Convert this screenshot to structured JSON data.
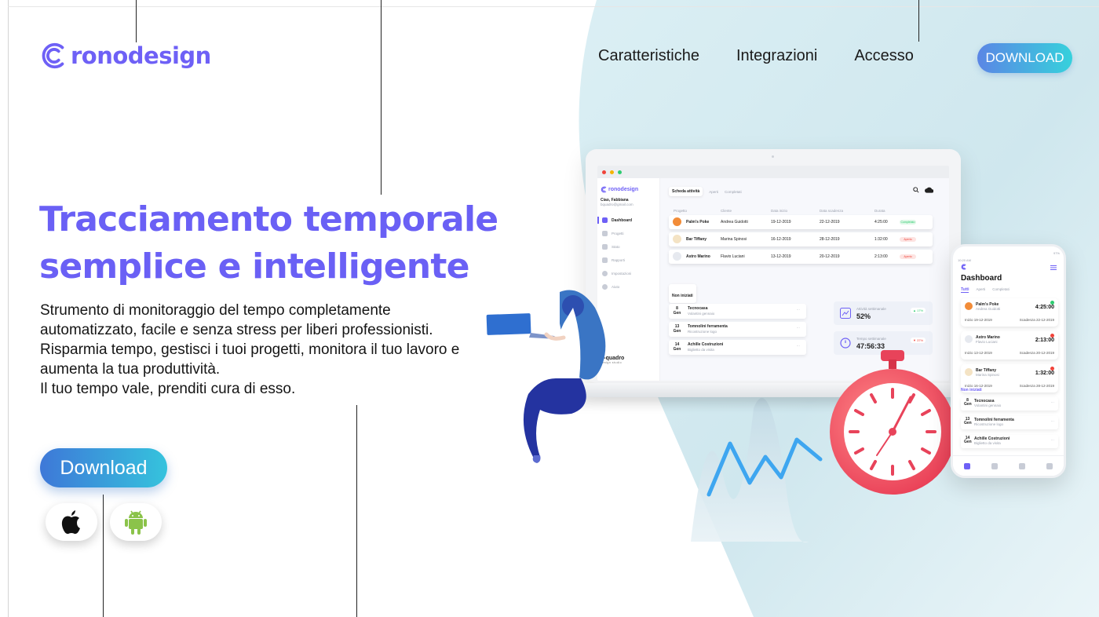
{
  "brand": {
    "logo_text": "ronodesign",
    "logo_letter": "C",
    "colors": {
      "primary": "#6a60f5",
      "cta_start": "#5b86e5",
      "cta_end": "#36d1dc"
    }
  },
  "nav": {
    "items": [
      "Caratteristiche",
      "Integrazioni",
      "Accesso"
    ],
    "cta_label": "DOWNLOAD"
  },
  "hero": {
    "title_line1": "Tracciamento temporale",
    "title_line2": "semplice e intelligente",
    "description": [
      "Strumento di monitoraggio del tempo completamente automatizzato, facile e senza stress per liberi professionisti.",
      "Risparmia tempo, gestisci i tuoi progetti, monitora il tuo lavoro e aumenta la tua produttività.",
      "Il tuo tempo vale, prenditi cura di esso."
    ],
    "download_label": "Download",
    "stores": [
      {
        "name": "apple",
        "icon": "apple-icon"
      },
      {
        "name": "android",
        "icon": "android-icon"
      }
    ]
  },
  "laptop_app": {
    "logo_text": "ronodesign",
    "user_name": "Ciao, Fabbiana",
    "user_email": "bquadro@gmail.com",
    "sidebar": [
      "Dashboard",
      "Progetti",
      "Stato",
      "Rapporti",
      "Impostazioni",
      "Aiuto"
    ],
    "sidebar_footer": "b-quadro",
    "sidebar_footer_sub": "design studio",
    "tabs": [
      "Scheda attività",
      "Aperti",
      "Completati"
    ],
    "table_headers": [
      "Progetto",
      "Cliente",
      "Data inizio",
      "Data scadenza",
      "Durata"
    ],
    "rows": [
      {
        "project": "Palm's Poke",
        "client": "Andrea Guidotti",
        "start": "19-12-2019",
        "end": "22-12-2019",
        "duration": "4:25:00",
        "status": "Completato",
        "status_color": "#2ecc71"
      },
      {
        "project": "Bar Tiffany",
        "client": "Marina Spinosi",
        "start": "16-12-2019",
        "end": "28-12-2019",
        "duration": "1:32:00",
        "status": "Aperto",
        "status_color": "#f0433a"
      },
      {
        "project": "Astro Marino",
        "client": "Flavio Luciani",
        "start": "13-12-2019",
        "end": "20-12-2019",
        "duration": "2:13:00",
        "status": "Aperto",
        "status_color": "#f0433a"
      }
    ],
    "not_started_label": "Non iniziati",
    "tasks": [
      {
        "day": "8",
        "month": "Gen",
        "title": "Tecnocasa",
        "sub": "Volantini gennaio"
      },
      {
        "day": "13",
        "month": "Gen",
        "title": "Tomnolini ferramenta",
        "sub": "Ricostruzione logo"
      },
      {
        "day": "14",
        "month": "Gen",
        "title": "Achille Costruzioni",
        "sub": "Biglietto da visita"
      }
    ],
    "stats": [
      {
        "label": "Attività settimanale",
        "value": "52%",
        "delta": "17%",
        "delta_color": "#2ecc71"
      },
      {
        "label": "Tempo settimanale",
        "value": "47:56:33",
        "delta": "37%",
        "delta_color": "#f0433a"
      }
    ]
  },
  "phone_app": {
    "time": "10:20 AM",
    "battery": "97%",
    "title": "Dashboard",
    "tabs": [
      "Tutti",
      "Aperti",
      "Completati"
    ],
    "cards": [
      {
        "project": "Palm's Poke",
        "client": "Andrea Guidotti",
        "duration": "4:25:00",
        "start": "Inizio 19-12-2019",
        "end": "Scadenza 22-12-2019",
        "dot_color": "#2ecc71"
      },
      {
        "project": "Astro Marino",
        "client": "Flavio Luciani",
        "duration": "2:13:00",
        "start": "Inizio 13-12-2019",
        "end": "Scadenza 20-12-2019",
        "dot_color": "#f0433a"
      },
      {
        "project": "Bar Tiffany",
        "client": "Marina Spinosi",
        "duration": "1:32:00",
        "start": "Inizio 16-12-2019",
        "end": "Scadenza 28-12-2019",
        "dot_color": "#f0433a"
      }
    ],
    "not_started_label": "Non iniziati",
    "tasks": [
      {
        "day": "8",
        "month": "Gen",
        "title": "Tecnocasa",
        "sub": "Volantini gennaio"
      },
      {
        "day": "13",
        "month": "Gen",
        "title": "Tomnolini ferramenta",
        "sub": "Ricostruzione logo"
      },
      {
        "day": "14",
        "month": "Gen",
        "title": "Achille Costruzioni",
        "sub": "Biglietto da visita"
      }
    ]
  }
}
